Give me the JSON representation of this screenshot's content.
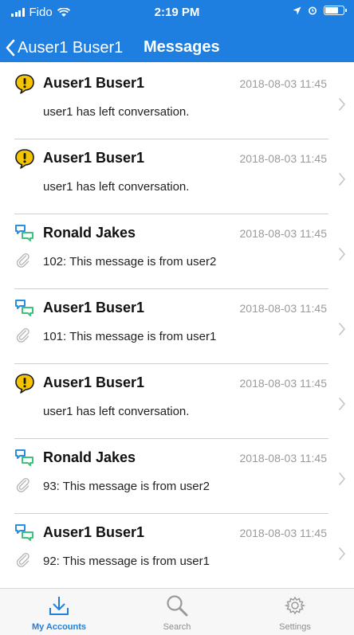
{
  "status_bar": {
    "carrier": "Fido",
    "time": "2:19 PM"
  },
  "nav": {
    "back_label": "Auser1 Buser1",
    "title": "Messages"
  },
  "messages": [
    {
      "icon": "warning-icon",
      "name": "Auser1 Buser1",
      "date": "2018-08-03 11:45",
      "text": "user1 has left conversation.",
      "attachment": false
    },
    {
      "icon": "warning-icon",
      "name": "Auser1 Buser1",
      "date": "2018-08-03 11:45",
      "text": "user1 has left conversation.",
      "attachment": false
    },
    {
      "icon": "chat-icon",
      "name": "Ronald Jakes",
      "date": "2018-08-03 11:45",
      "text": "102: This message is from user2",
      "attachment": true
    },
    {
      "icon": "chat-icon",
      "name": "Auser1 Buser1",
      "date": "2018-08-03 11:45",
      "text": "101: This message is from user1",
      "attachment": true
    },
    {
      "icon": "warning-icon",
      "name": "Auser1 Buser1",
      "date": "2018-08-03 11:45",
      "text": "user1 has left conversation.",
      "attachment": false
    },
    {
      "icon": "chat-icon",
      "name": "Ronald Jakes",
      "date": "2018-08-03 11:45",
      "text": "93: This message is from user2",
      "attachment": true
    },
    {
      "icon": "chat-icon",
      "name": "Auser1 Buser1",
      "date": "2018-08-03 11:45",
      "text": "92: This message is from user1",
      "attachment": true
    }
  ],
  "tabs": [
    {
      "label": "My Accounts",
      "icon": "download-icon",
      "active": true
    },
    {
      "label": "Search",
      "icon": "search-icon",
      "active": false
    },
    {
      "label": "Settings",
      "icon": "gear-icon",
      "active": false
    }
  ],
  "colors": {
    "accent": "#1e7fe0",
    "warning_fill": "#f5c400",
    "chat_blue": "#2a8fe0",
    "chat_green": "#3cc47a"
  }
}
